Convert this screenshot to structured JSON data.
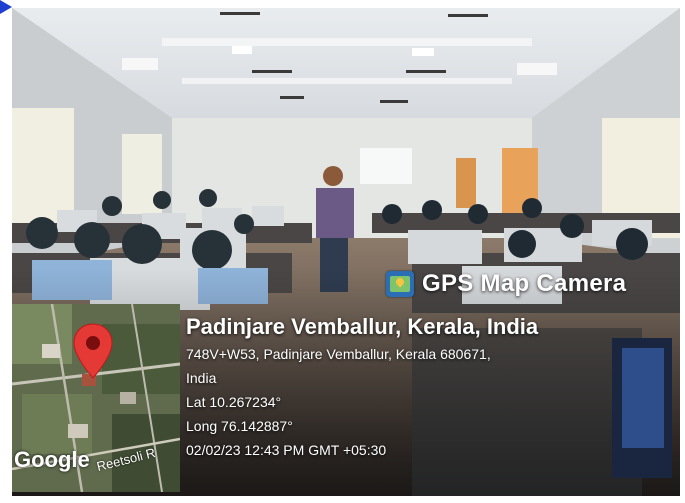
{
  "geotag": {
    "app_name": "GPS Map Camera",
    "place": "Padinjare Vemballur, Kerala, India",
    "address_line1": "748V+W53, Padinjare Vemballur, Kerala 680671,",
    "address_line2": "India",
    "latitude": "Lat 10.267234°",
    "longitude": "Long 76.142887°",
    "datetime": "02/02/23 12:43 PM GMT +05:30"
  },
  "map": {
    "provider": "Google",
    "road_label": "Reetsoli R",
    "pin_icon": "map-pin-icon",
    "pin_color": "#e53935"
  },
  "colors": {
    "corner_arrow": "#1f3fd1"
  }
}
